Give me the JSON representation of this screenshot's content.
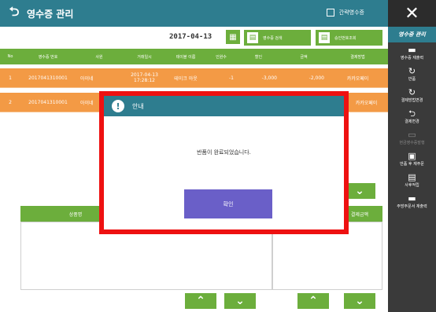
{
  "header": {
    "title": "영수증 관리",
    "checkbox_label": "간략영수증"
  },
  "toolbar": {
    "date": "2017-04-13",
    "search_label": "영수증 검색",
    "approval_label": "승인번호조회"
  },
  "table": {
    "no_header": "No",
    "headers": [
      "영수증 번호",
      "사원",
      "거래일시",
      "테이블 이름",
      "인원수",
      "할인",
      "금액",
      "결제방법"
    ],
    "rows": [
      {
        "no": "1",
        "receipt": "2017041310001",
        "staff": "아이네",
        "datetime_date": "2017-04-13",
        "datetime_time": "17:28:12",
        "table": "테이크 아웃",
        "people": "-1",
        "discount": "-3,000",
        "amount": "-2,000",
        "payment": "카카오페이"
      },
      {
        "no": "2",
        "receipt": "2017041310001",
        "staff": "아이네",
        "datetime_date": "",
        "datetime_time": "",
        "table": "",
        "people": "",
        "discount": "",
        "amount": "",
        "payment": "카카오페이"
      }
    ]
  },
  "lower": {
    "left_header": "상품명",
    "right_header": "결제금액"
  },
  "sidebar": {
    "close_icon": "close-icon",
    "menu_title": "영수증 관리",
    "items": [
      {
        "label": "영수증 재출력",
        "icon": "card-icon"
      },
      {
        "label": "반품",
        "icon": "refresh-icon"
      },
      {
        "label": "결제방법변경",
        "icon": "refresh-icon"
      },
      {
        "label": "결제변경",
        "icon": "return-icon"
      },
      {
        "label": "현금영수증발행",
        "icon": "card-icon"
      },
      {
        "label": "반품 후 재주문",
        "icon": "reorder-icon"
      },
      {
        "label": "사후적립",
        "icon": "point-icon"
      },
      {
        "label": "주방주문서 재출력",
        "icon": "card-icon"
      }
    ]
  },
  "dialog": {
    "title": "안내",
    "message": "반품이 완료되었습니다.",
    "ok_label": "확인"
  },
  "colors": {
    "teal": "#2e7d8f",
    "green": "#6cae3c",
    "orange": "#f39a45",
    "purple": "#6a5fc8",
    "red": "#ee1111"
  }
}
